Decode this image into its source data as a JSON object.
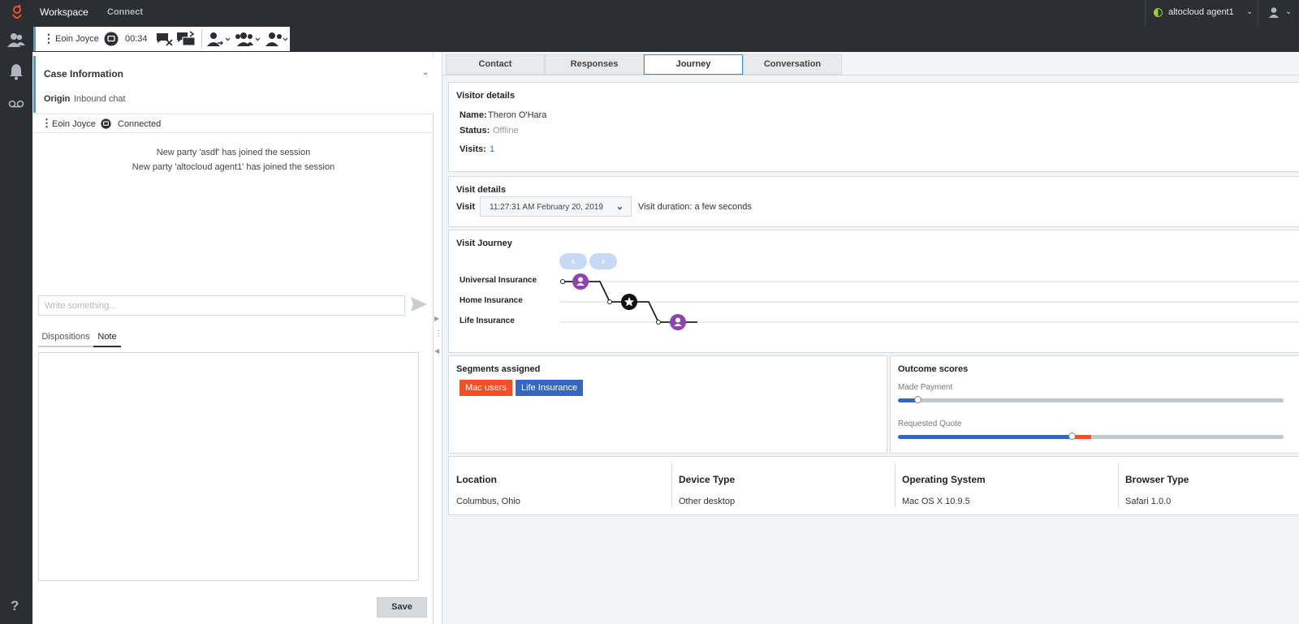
{
  "topbar": {
    "title": "Workspace",
    "connect": "Connect",
    "agent_name": "altocloud agent1"
  },
  "toolbar": {
    "party": "Eoin Joyce",
    "timer": "00:34"
  },
  "case": {
    "title": "Case Information",
    "origin_label": "Origin",
    "origin_value": "Inbound chat"
  },
  "party_row": {
    "name": "Eoin Joyce",
    "status": "Connected"
  },
  "transcript": [
    "New party 'asdf' has joined the session",
    "New party 'altocloud agent1' has joined the session"
  ],
  "composer": {
    "placeholder": "Write something..."
  },
  "disposition_tabs": {
    "dispositions": "Dispositions",
    "note": "Note"
  },
  "save_label": "Save",
  "tabs": [
    "Contact",
    "Responses",
    "Journey",
    "Conversation"
  ],
  "active_tab": "Journey",
  "visitor": {
    "title": "Visitor details",
    "name_label": "Name:",
    "name": "Theron O'Hara",
    "status_label": "Status:",
    "status": "Offline",
    "visits_label": "Visits:",
    "visits": "1"
  },
  "visit_details": {
    "title": "Visit details",
    "visit_label": "Visit",
    "visit_selected": "11:27:31 AM February 20, 2019",
    "duration": "Visit duration: a few seconds"
  },
  "visit_journey": {
    "title": "Visit Journey",
    "rows": [
      "Universal Insurance",
      "Home Insurance",
      "Life Insurance"
    ]
  },
  "segments": {
    "title": "Segments assigned",
    "items": [
      {
        "label": "Mac users",
        "color": "#f25022"
      },
      {
        "label": "Life Insurance",
        "color": "#3467c2"
      }
    ]
  },
  "outcomes": {
    "title": "Outcome scores",
    "items": [
      {
        "label": "Made Payment",
        "score": 0.05,
        "red_extent": 0
      },
      {
        "label": "Requested Quote",
        "score": 0.45,
        "red_extent": 0.05
      }
    ]
  },
  "info": [
    {
      "heading": "Location",
      "value": "Columbus, Ohio"
    },
    {
      "heading": "Device Type",
      "value": "Other desktop"
    },
    {
      "heading": "Operating System",
      "value": "Mac OS X 10.9.5"
    },
    {
      "heading": "Browser Type",
      "value": "Safari 1.0.0"
    }
  ],
  "colors": {
    "accent": "#3fa6c6",
    "journey_purple": "#8e44ad",
    "online_dot": "#9acd32"
  }
}
